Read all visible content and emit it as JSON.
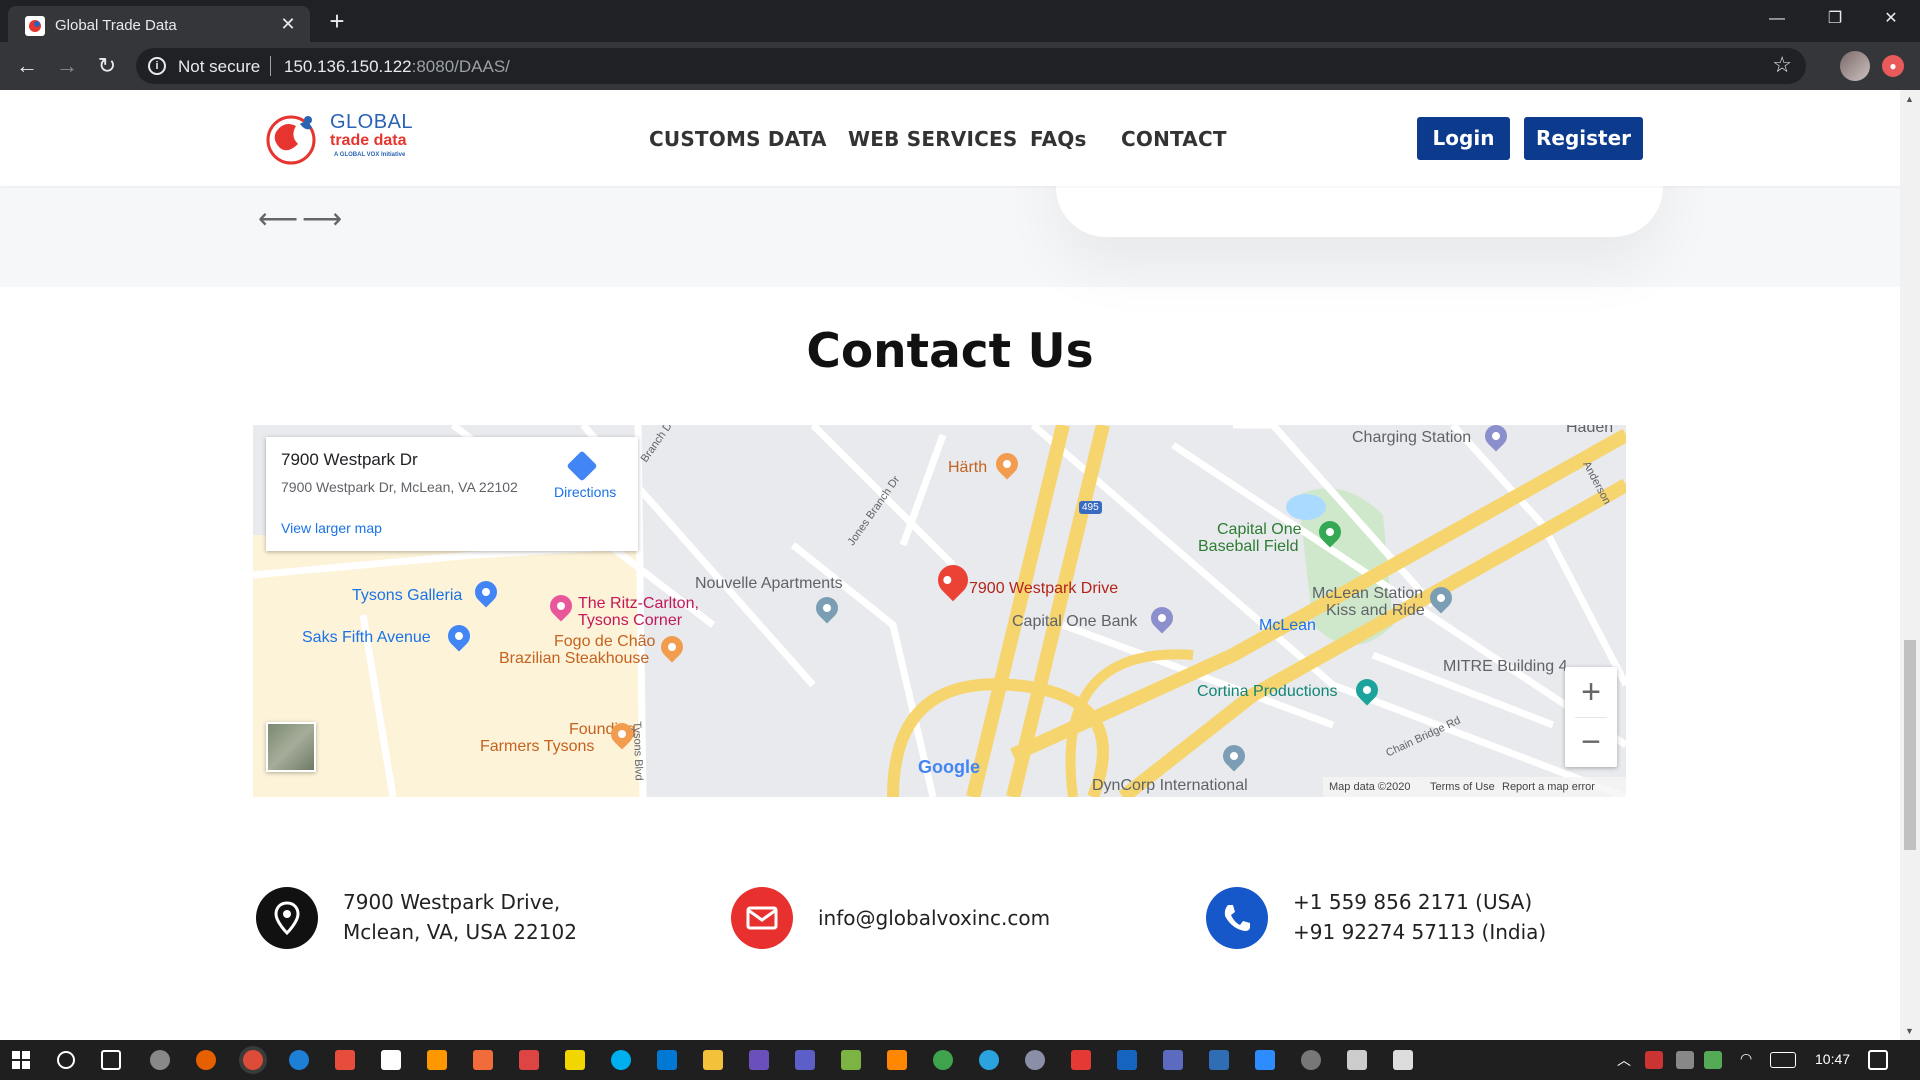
{
  "browser": {
    "tab_title": "Global Trade Data",
    "not_secure": "Not secure",
    "url_host": "150.136.150.122",
    "url_rest": ":8080/DAAS/"
  },
  "header": {
    "logo": {
      "line1": "GLOBAL",
      "line2": "trade data",
      "line3": "A GLOBAL VOX Initiative"
    },
    "nav": [
      "CUSTOMS DATA",
      "WEB SERVICES",
      "FAQs",
      "CONTACT"
    ],
    "login": "Login",
    "register": "Register"
  },
  "testimonial_nav": {
    "prev": "⟵",
    "next": "⟶"
  },
  "contact": {
    "title": "Contact Us",
    "map": {
      "card_title": "7900 Westpark Dr",
      "card_address": "7900 Westpark Dr, McLean, VA 22102",
      "directions": "Directions",
      "view_larger": "View larger map",
      "labels": {
        "charging": "Charging Station",
        "haden": "Haden",
        "harth": "Härth",
        "capital_one_field_1": "Capital One",
        "capital_one_field_2": "Baseball Field",
        "tysons_galleria": "Tysons Galleria",
        "ritz_1": "The Ritz-Carlton,",
        "ritz_2": "Tysons Corner",
        "nouvelle": "Nouvelle Apartments",
        "pin_label": "7900 Westpark Drive",
        "mclean_station_1": "McLean Station",
        "mclean_station_2": "Kiss and Ride",
        "saks": "Saks Fifth Avenue",
        "fogo_1": "Fogo de Chão",
        "fogo_2": "Brazilian Steakhouse",
        "capital_one_bank": "Capital One Bank",
        "mclean": "McLean",
        "mitre": "MITRE Building 4",
        "cortina": "Cortina Productions",
        "founding_1": "Founding",
        "founding_2": "Farmers Tysons",
        "dyncorp": "DynCorp International",
        "anderson": "Anderson",
        "chain_bridge": "Chain Bridge Rd",
        "jones_branch": "Jones Branch Dr",
        "branch_dr": "Branch Dr",
        "tysons_blvd": "Tysons Blvd",
        "i495": "495"
      },
      "google": "Google",
      "footer": {
        "data": "Map data ©2020",
        "terms": "Terms of Use",
        "report": "Report a map error"
      },
      "zoom_in": "+",
      "zoom_out": "−"
    },
    "address_1": "7900 Westpark Drive,",
    "address_2": "Mclean, VA, USA 22102",
    "email": "info@globalvoxinc.com",
    "phone_1": "+1 559 856 2171 (USA)",
    "phone_2": "+91 92274 57113 (India)"
  },
  "taskbar": {
    "time": "10:47"
  },
  "colors": {
    "brand_blue": "#0c3a8c",
    "email_red": "#e8312f",
    "phone_blue": "#1657c9",
    "pin_black": "#111111"
  }
}
